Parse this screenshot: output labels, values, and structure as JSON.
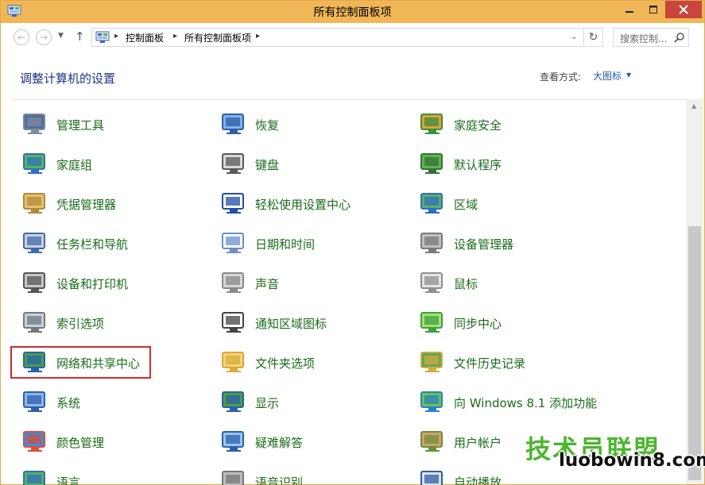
{
  "window": {
    "title": "所有控制面板项"
  },
  "address": {
    "crumbs": [
      "控制面板",
      "所有控制面板项"
    ],
    "search_placeholder": "搜索控制...",
    "icon": "control-panel-icon"
  },
  "header": {
    "heading": "调整计算机的设置",
    "view_by_label": "查看方式:",
    "view_by_value": "大图标"
  },
  "items": [
    {
      "label": "管理工具",
      "icon": "admin-tools-icon"
    },
    {
      "label": "恢复",
      "icon": "recovery-icon"
    },
    {
      "label": "家庭安全",
      "icon": "family-safety-icon"
    },
    {
      "label": "家庭组",
      "icon": "homegroup-icon"
    },
    {
      "label": "键盘",
      "icon": "keyboard-icon"
    },
    {
      "label": "默认程序",
      "icon": "default-programs-icon"
    },
    {
      "label": "凭据管理器",
      "icon": "credential-manager-icon"
    },
    {
      "label": "轻松使用设置中心",
      "icon": "ease-of-access-icon"
    },
    {
      "label": "区域",
      "icon": "region-icon"
    },
    {
      "label": "任务栏和导航",
      "icon": "taskbar-icon"
    },
    {
      "label": "日期和时间",
      "icon": "date-time-icon"
    },
    {
      "label": "设备管理器",
      "icon": "device-manager-icon"
    },
    {
      "label": "设备和打印机",
      "icon": "devices-printers-icon"
    },
    {
      "label": "声音",
      "icon": "sound-icon"
    },
    {
      "label": "鼠标",
      "icon": "mouse-icon"
    },
    {
      "label": "索引选项",
      "icon": "indexing-icon"
    },
    {
      "label": "通知区域图标",
      "icon": "notification-area-icon"
    },
    {
      "label": "同步中心",
      "icon": "sync-center-icon"
    },
    {
      "label": "网络和共享中心",
      "icon": "network-sharing-icon"
    },
    {
      "label": "文件夹选项",
      "icon": "folder-options-icon"
    },
    {
      "label": "文件历史记录",
      "icon": "file-history-icon"
    },
    {
      "label": "系统",
      "icon": "system-icon"
    },
    {
      "label": "显示",
      "icon": "display-icon"
    },
    {
      "label": "向 Windows 8.1 添加功能",
      "icon": "add-features-icon"
    },
    {
      "label": "颜色管理",
      "icon": "color-management-icon"
    },
    {
      "label": "疑难解答",
      "icon": "troubleshooting-icon"
    },
    {
      "label": "用户帐户",
      "icon": "user-accounts-icon"
    },
    {
      "label": "语言",
      "icon": "language-icon"
    },
    {
      "label": "语音识别",
      "icon": "speech-recognition-icon"
    },
    {
      "label": "自动播放",
      "icon": "autoplay-icon"
    }
  ],
  "watermark": {
    "brand": "技术员联盟",
    "domain": "luobowin8.com"
  },
  "colors": {
    "titlebar": "#f1b757",
    "link_green": "#1a6b1a",
    "heading_blue": "#1e3287",
    "highlight_red": "#d32a2a"
  }
}
